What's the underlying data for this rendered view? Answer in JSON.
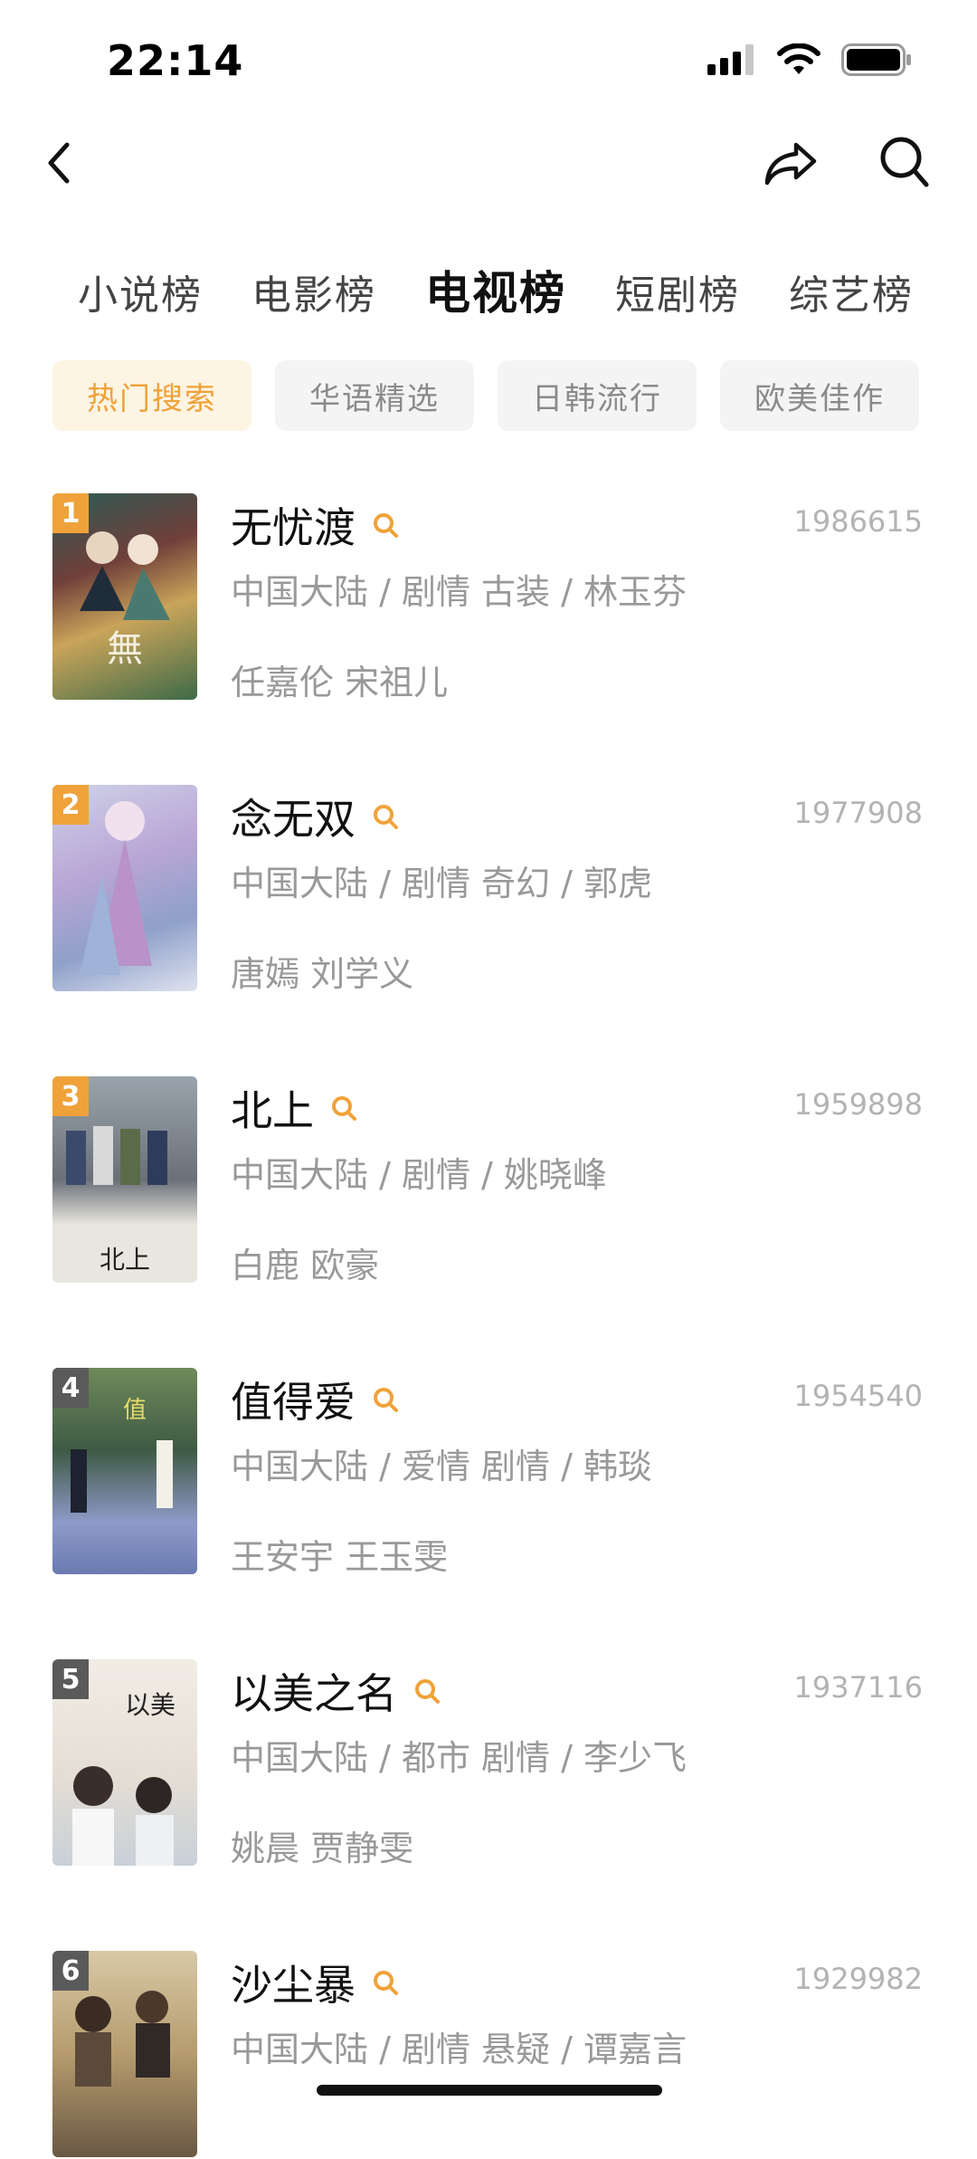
{
  "status": {
    "time": "22:14"
  },
  "tabs": [
    {
      "label": "小说榜"
    },
    {
      "label": "电影榜"
    },
    {
      "label": "电视榜",
      "active": true
    },
    {
      "label": "短剧榜"
    },
    {
      "label": "综艺榜"
    }
  ],
  "chips": [
    {
      "label": "热门搜索",
      "active": true
    },
    {
      "label": "华语精选"
    },
    {
      "label": "日韩流行"
    },
    {
      "label": "欧美佳作"
    }
  ],
  "list": [
    {
      "rank": "1",
      "title": "无忧渡",
      "score": "1986615",
      "meta": "中国大陆 / 剧情 古装 / 林玉芬",
      "cast": "任嘉伦 宋祖儿",
      "rank_color": "#f0a23a"
    },
    {
      "rank": "2",
      "title": "念无双",
      "score": "1977908",
      "meta": "中国大陆 / 剧情 奇幻 / 郭虎",
      "cast": "唐嫣 刘学义",
      "rank_color": "#f0a23a"
    },
    {
      "rank": "3",
      "title": "北上",
      "score": "1959898",
      "meta": "中国大陆 / 剧情 / 姚晓峰",
      "cast": "白鹿 欧豪",
      "rank_color": "#f0a23a"
    },
    {
      "rank": "4",
      "title": "值得爱",
      "score": "1954540",
      "meta": "中国大陆 / 爱情 剧情 / 韩琰",
      "cast": "王安宇 王玉雯",
      "rank_color": "#5a5a5a"
    },
    {
      "rank": "5",
      "title": "以美之名",
      "score": "1937116",
      "meta": "中国大陆 / 都市 剧情 / 李少飞",
      "cast": "姚晨 贾静雯",
      "rank_color": "#5a5a5a"
    },
    {
      "rank": "6",
      "title": "沙尘暴",
      "score": "1929982",
      "meta": "中国大陆 / 剧情 悬疑 / 谭嘉言",
      "cast": "",
      "rank_color": "#5a5a5a"
    }
  ],
  "colors": {
    "accent": "#f0a23a",
    "chip_active_bg": "#fdf4e3"
  },
  "icons": [
    "back-icon",
    "share-icon",
    "search-icon",
    "signal-icon",
    "wifi-icon",
    "battery-icon"
  ]
}
